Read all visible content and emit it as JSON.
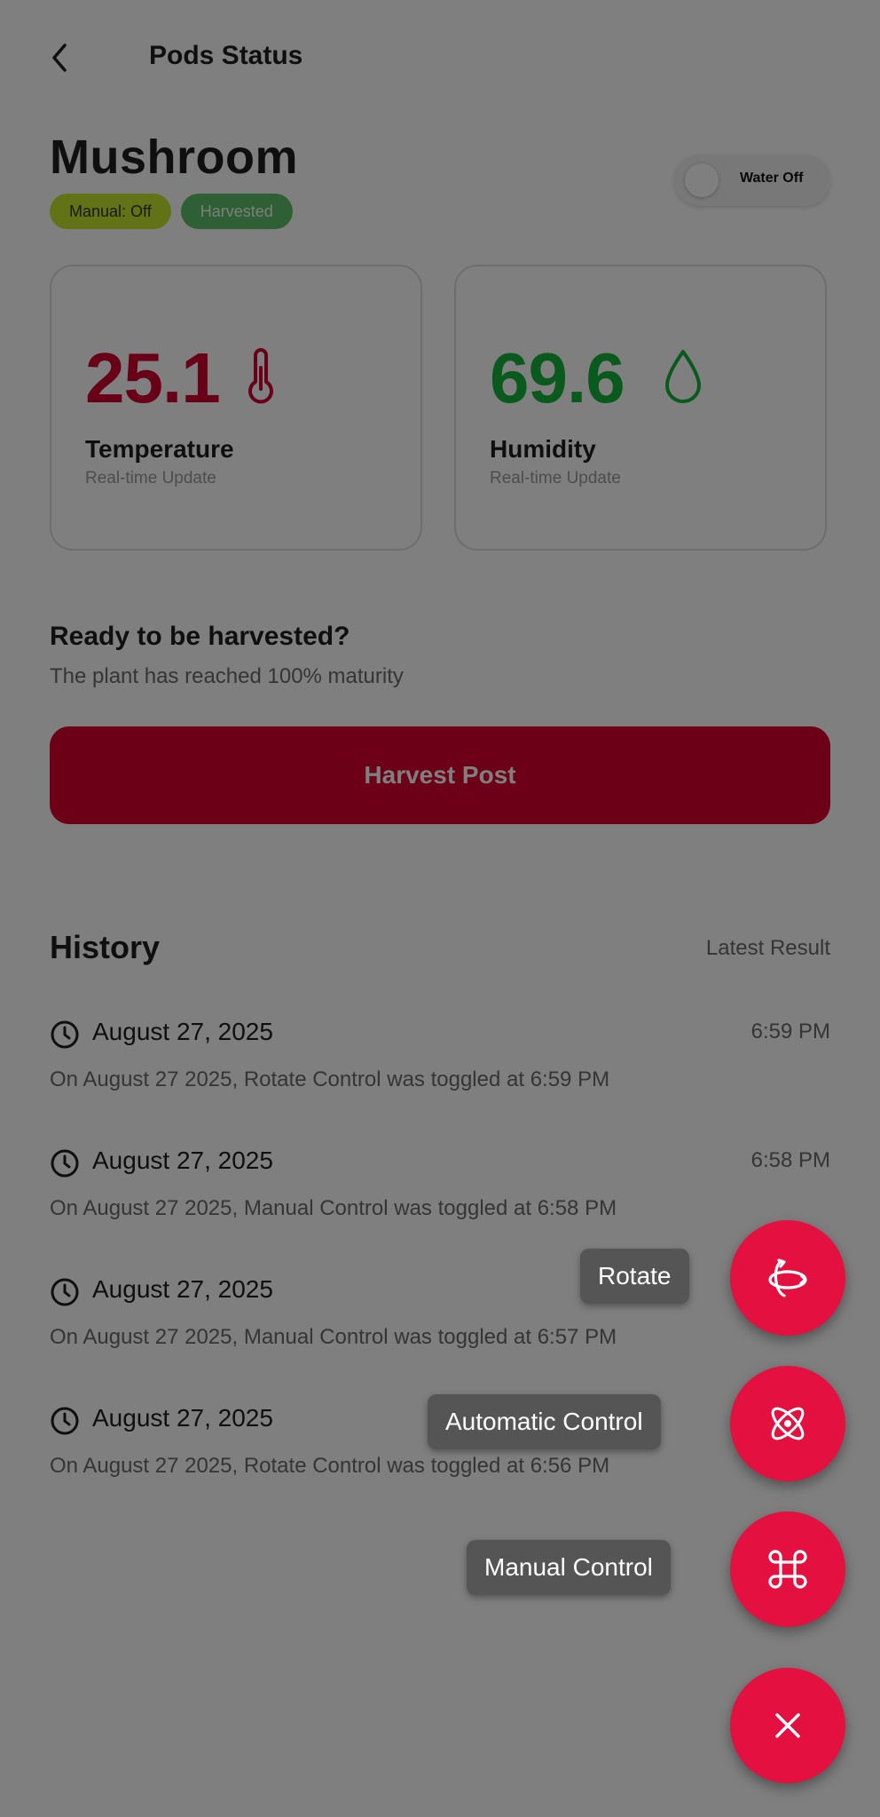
{
  "header": {
    "title": "Pods Status",
    "back_icon": "chevron-left-icon"
  },
  "pod": {
    "name": "Mushroom",
    "badges": [
      {
        "label": "Manual: Off",
        "color": "#c5e52e"
      },
      {
        "label": "Harvested",
        "color": "#5fbf6a"
      }
    ],
    "water_toggle": {
      "label": "Water Off",
      "on": false
    }
  },
  "metrics": {
    "temperature": {
      "value": "25.1",
      "label": "Temperature",
      "sub": "Real-time Update",
      "icon": "thermometer-icon",
      "color": "#d10030"
    },
    "humidity": {
      "value": "69.6",
      "label": "Humidity",
      "sub": "Real-time Update",
      "icon": "droplet-icon",
      "color": "#15b43c"
    }
  },
  "harvest": {
    "title": "Ready to be harvested?",
    "subtitle": "The plant has reached 100% maturity",
    "button_label": "Harvest Post",
    "button_color": "#d9002c"
  },
  "history": {
    "title": "History",
    "latest_label": "Latest Result",
    "items": [
      {
        "date": "August 27, 2025",
        "time": "6:59 PM",
        "desc": "On August 27 2025, Rotate Control was toggled at 6:59 PM"
      },
      {
        "date": "August 27, 2025",
        "time": "6:58 PM",
        "desc": "On August 27 2025, Manual Control was toggled at 6:58 PM"
      },
      {
        "date": "August 27, 2025",
        "time": "",
        "desc": "On August 27 2025, Manual Control was toggled at 6:57 PM"
      },
      {
        "date": "August 27, 2025",
        "time": "",
        "desc": "On August 27 2025, Rotate Control was toggled at 6:56 PM"
      }
    ]
  },
  "fab_menu": {
    "accent": "#e4103f",
    "actions": [
      {
        "label": "Rotate",
        "icon": "rotate-3d-icon"
      },
      {
        "label": "Automatic Control",
        "icon": "atom-icon"
      },
      {
        "label": "Manual Control",
        "icon": "command-icon"
      }
    ],
    "close_icon": "close-icon"
  }
}
